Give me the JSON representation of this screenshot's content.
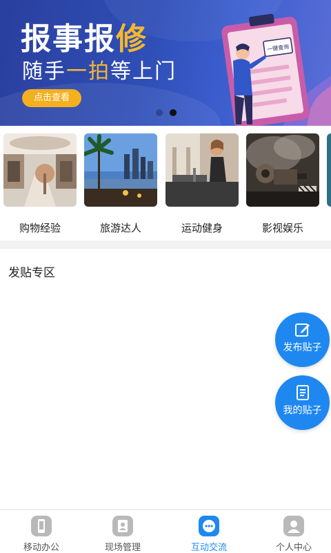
{
  "banner": {
    "title_a": "报事报",
    "title_b": "修",
    "subtitle_a": "随手",
    "subtitle_b": "一拍",
    "subtitle_c": "等上门",
    "button_label": "点击查看",
    "sign_text": "一键查询",
    "pages": 2,
    "active_page": 2
  },
  "categories": [
    {
      "label": "购物经验"
    },
    {
      "label": "旅游达人"
    },
    {
      "label": "运动健身"
    },
    {
      "label": "影视娱乐"
    }
  ],
  "section": {
    "title": "发贴专区"
  },
  "fabs": {
    "publish_label": "发布贴子",
    "mine_label": "我的贴子"
  },
  "tabbar": {
    "items": [
      {
        "label": "移动办公",
        "icon": "mobile-office-icon"
      },
      {
        "label": "现场管理",
        "icon": "site-management-icon"
      },
      {
        "label": "互动交流",
        "icon": "interaction-icon"
      },
      {
        "label": "个人中心",
        "icon": "personal-center-icon"
      }
    ],
    "active_index": 2
  },
  "colors": {
    "accent": "#1f88f0",
    "banner_bg": "#2f4fb7",
    "highlight": "#f5b82e"
  }
}
